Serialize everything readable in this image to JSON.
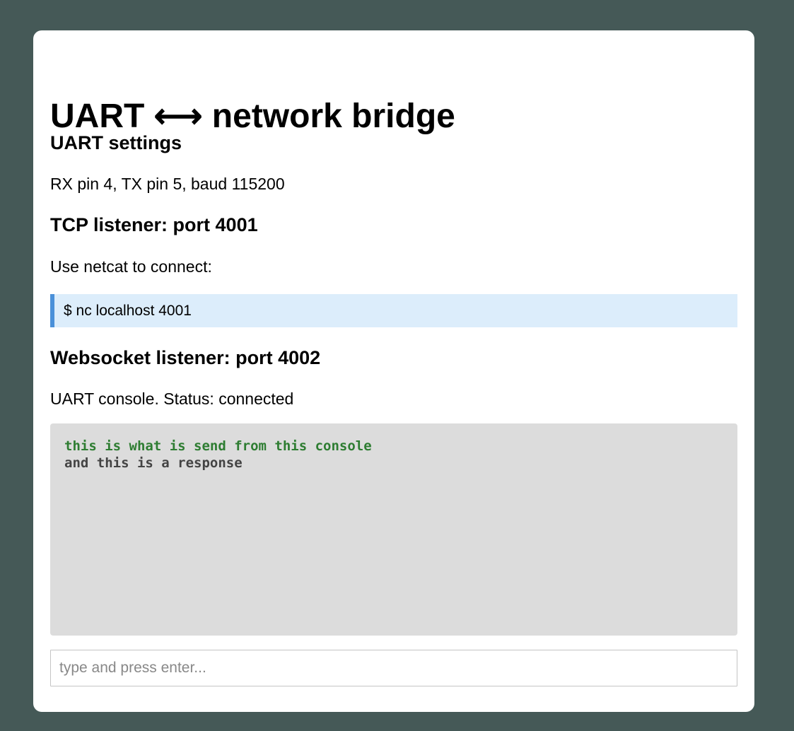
{
  "page": {
    "title": "UART ⟷ network bridge"
  },
  "uart": {
    "heading": "UART settings",
    "details": "RX pin 4, TX pin 5, baud 115200"
  },
  "tcp": {
    "heading": "TCP listener: port 4001",
    "instructions": "Use netcat to connect:",
    "command": "$ nc localhost 4001"
  },
  "websocket": {
    "heading": "Websocket listener: port 4002",
    "status_line": "UART console. Status: connected"
  },
  "console": {
    "lines": [
      {
        "text": "this is what is send from this console",
        "direction": "sent"
      },
      {
        "text": "and this is a response",
        "direction": "received"
      }
    ],
    "input_placeholder": "type and press enter...",
    "input_value": ""
  },
  "colors": {
    "background": "#455957",
    "card": "#ffffff",
    "command_block_bg": "#dcedfb",
    "command_block_accent": "#4a90d9",
    "console_bg": "#dcdcdc",
    "sent_text": "#2e7d32",
    "received_text": "#444444"
  }
}
